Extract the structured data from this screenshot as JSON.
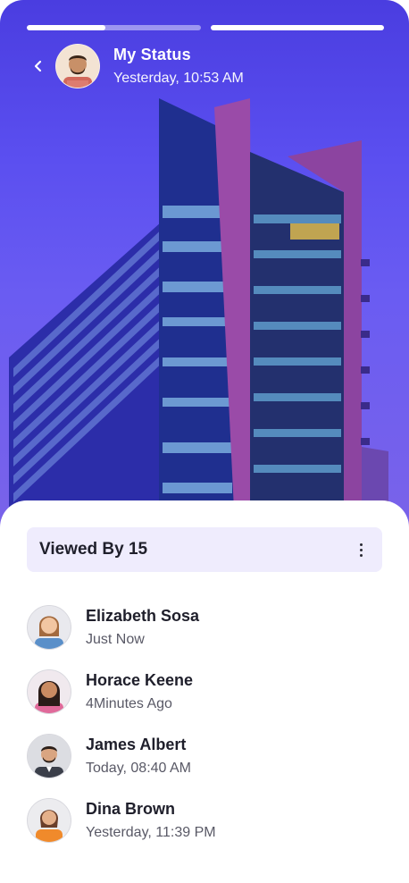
{
  "status": {
    "title": "My Status",
    "timestamp": "Yesterday, 10:53 AM",
    "progress": [
      0.45,
      1.0
    ],
    "back_icon": "chevron-left-icon"
  },
  "viewers": {
    "label": "Viewed By 15",
    "menu_icon": "more-vertical-icon",
    "items": [
      {
        "name": "Elizabeth Sosa",
        "time": "Just Now"
      },
      {
        "name": "Horace Keene",
        "time": "4Minutes Ago"
      },
      {
        "name": "James Albert",
        "time": "Today, 08:40 AM"
      },
      {
        "name": "Dina Brown",
        "time": "Yesterday, 11:39 PM"
      }
    ]
  },
  "colors": {
    "accent": "#5b4ff0",
    "viewed_bar_bg": "#efecfd"
  }
}
